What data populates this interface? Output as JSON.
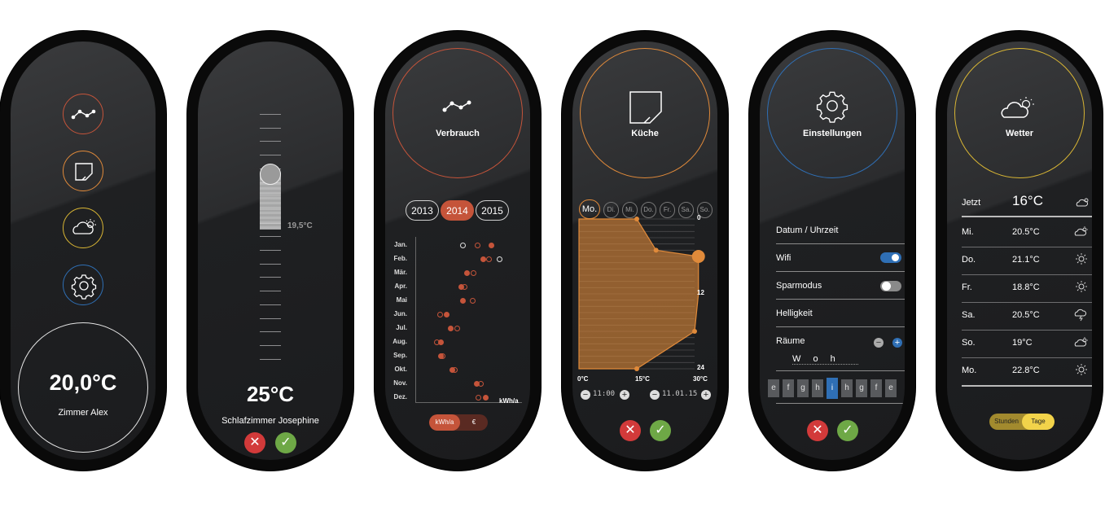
{
  "panel1": {
    "temperature": "20,0°C",
    "room": "Zimmer Alex",
    "icons": [
      "chart-icon",
      "room-icon",
      "weather-icon",
      "settings-icon"
    ],
    "colors": {
      "chart": "#c5543a",
      "room": "#e08a3a",
      "weather": "#d9b634",
      "settings": "#2f6fb5",
      "main": "#e6e6e6"
    }
  },
  "panel2": {
    "setpoint_label": "19,5°C",
    "temperature": "25°C",
    "room": "Schlafzimmer Josephine",
    "cancel_icon": "close-icon",
    "confirm_icon": "check-icon"
  },
  "panel3": {
    "title": "Verbrauch",
    "years": [
      "2013",
      "2014",
      "2015"
    ],
    "selected_year": "2014",
    "unit_label": "kWh/a",
    "toggle": {
      "left": "kWh/a",
      "right": "€"
    },
    "accent": "#c5543a"
  },
  "chart_data": {
    "type": "scatter",
    "categories": [
      "Jan.",
      "Feb.",
      "Mär.",
      "Apr.",
      "Mai",
      "Jun.",
      "Jul.",
      "Aug.",
      "Sep.",
      "Okt.",
      "Nov.",
      "Dez."
    ],
    "xlabel": "kWh/a",
    "xlim": [
      0,
      100
    ],
    "series": [
      {
        "style": "filled",
        "values": [
          85,
          75,
          55,
          48,
          50,
          30,
          35,
          23,
          23,
          37,
          67,
          78
        ]
      },
      {
        "style": "hollow-orange",
        "values": [
          68,
          82,
          63,
          52,
          62,
          22,
          43,
          18,
          25,
          40,
          72,
          69
        ]
      },
      {
        "style": "hollow-white",
        "values": [
          50,
          95,
          null,
          null,
          null,
          null,
          null,
          null,
          null,
          null,
          null,
          null
        ]
      }
    ]
  },
  "panel4": {
    "title": "Küche",
    "days": [
      "Mo.",
      "Di.",
      "Mi.",
      "Do.",
      "Fr.",
      "Sa.",
      "So."
    ],
    "selected_day": "Mo.",
    "y_ticks": [
      "0",
      "12",
      "24"
    ],
    "x_ticks": [
      "0°C",
      "15°C",
      "30°C"
    ],
    "time_value": "11:00",
    "date_value": "11.01.15",
    "accent": "#e08a3a",
    "profile": [
      {
        "hour": 0,
        "temp": 15
      },
      {
        "hour": 5,
        "temp": 20
      },
      {
        "hour": 6,
        "temp": 31
      },
      {
        "hour": 12,
        "temp": 31
      },
      {
        "hour": 18,
        "temp": 30
      },
      {
        "hour": 24,
        "temp": 15
      }
    ]
  },
  "panel5": {
    "title": "Einstellungen",
    "items": [
      "Datum / Uhrzeit",
      "Wifi",
      "Sparmodus",
      "Helligkeit",
      "Räume"
    ],
    "wifi_on": true,
    "sparmodus_on": false,
    "name_input": "W o h",
    "keys": [
      "e",
      "f",
      "g",
      "h",
      "i",
      "h",
      "g",
      "f",
      "e"
    ],
    "selected_key": "i",
    "accent": "#2f6fb5"
  },
  "panel6": {
    "title": "Wetter",
    "now": {
      "day": "Jetzt",
      "temp": "16°C",
      "icon": "partly-cloudy-icon"
    },
    "forecast": [
      {
        "day": "Mi.",
        "temp": "20.5°C",
        "icon": "partly-cloudy-icon"
      },
      {
        "day": "Do.",
        "temp": "21.1°C",
        "icon": "sun-icon"
      },
      {
        "day": "Fr.",
        "temp": "18.8°C",
        "icon": "sun-icon"
      },
      {
        "day": "Sa.",
        "temp": "20.5°C",
        "icon": "thunder-icon"
      },
      {
        "day": "So.",
        "temp": "19°C",
        "icon": "partly-cloudy-icon"
      },
      {
        "day": "Mo.",
        "temp": "22.8°C",
        "icon": "sun-icon"
      }
    ],
    "toggle": {
      "left": "Stunden",
      "right": "Tage"
    },
    "accent": "#d9b634"
  }
}
